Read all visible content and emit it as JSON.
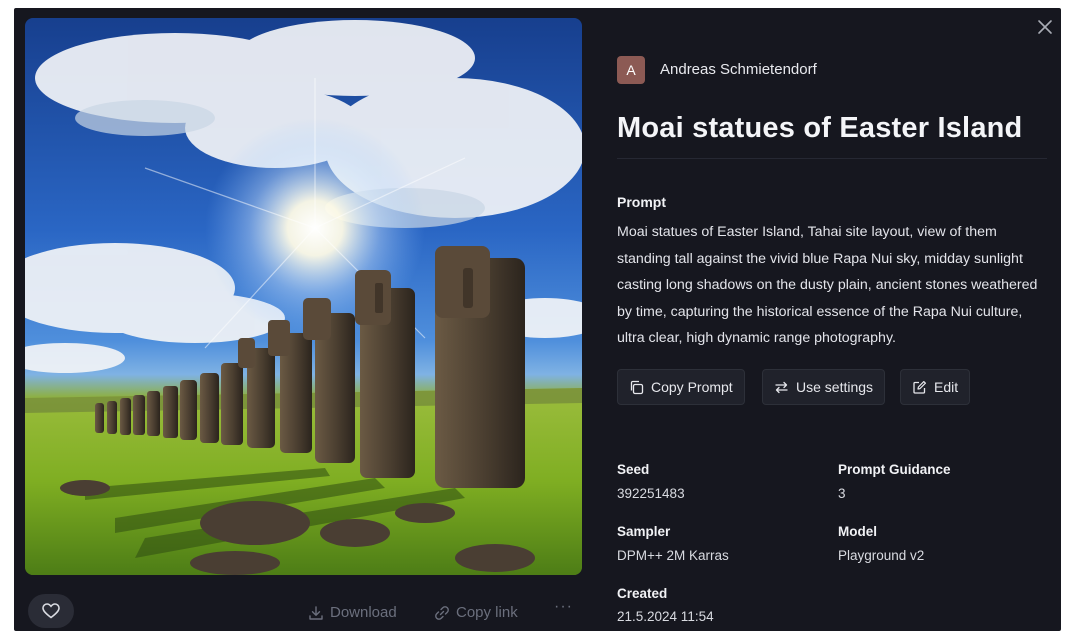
{
  "author": {
    "initial": "A",
    "name": "Andreas Schmietendorf"
  },
  "title": "Moai statues of Easter Island",
  "prompt": {
    "heading": "Prompt",
    "text": "Moai statues of Easter Island, Tahai site layout, view of them standing tall against the vivid blue Rapa Nui sky, midday sunlight casting long shadows on the dusty plain, ancient stones weathered by time, capturing the historical essence of the Rapa Nui culture, ultra clear, high dynamic range photography."
  },
  "buttons": {
    "copy_prompt": "Copy Prompt",
    "use_settings": "Use settings",
    "edit": "Edit"
  },
  "meta": {
    "seed_label": "Seed",
    "seed": "392251483",
    "guidance_label": "Prompt Guidance",
    "guidance": "3",
    "sampler_label": "Sampler",
    "sampler": "DPM++ 2M Karras",
    "model_label": "Model",
    "model": "Playground v2",
    "created_label": "Created",
    "created": "21.5.2024 11:54"
  },
  "bottom_bar": {
    "download": "Download",
    "copy_link": "Copy link",
    "more": "···"
  },
  "icons": {
    "close": "close-icon",
    "heart": "heart-icon",
    "download": "download-icon",
    "link": "link-icon",
    "copy": "copy-icon",
    "swap": "swap-icon",
    "edit": "edit-icon"
  },
  "colors": {
    "background": "#16171f",
    "avatar": "#8c5a54",
    "button": "#20222b",
    "muted_text": "#6b6f7d"
  }
}
